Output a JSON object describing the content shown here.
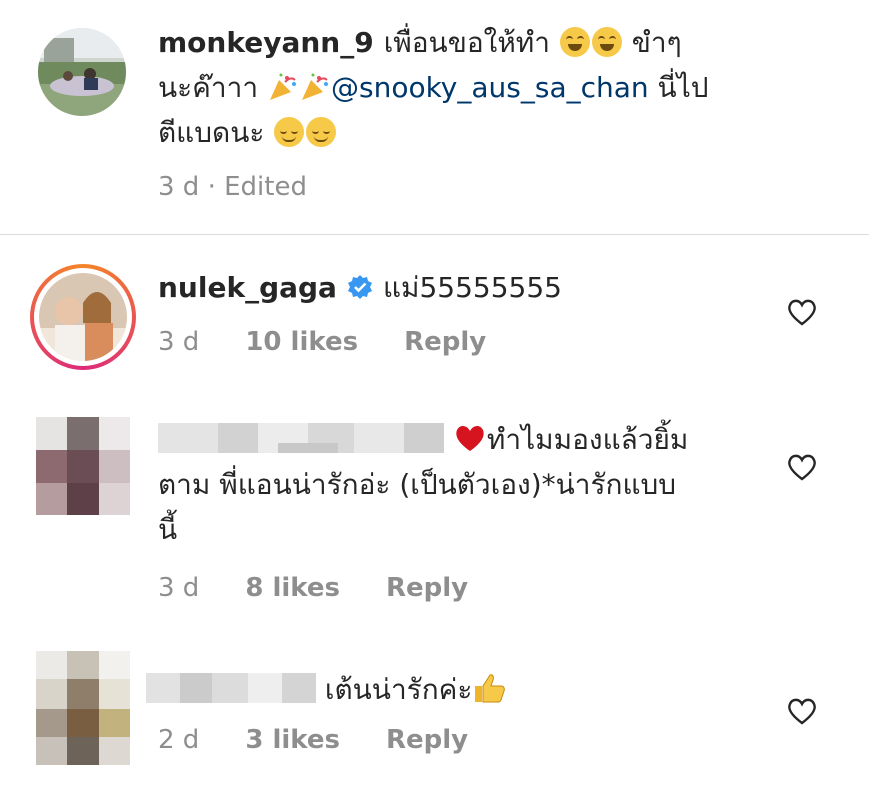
{
  "comments": [
    {
      "username": "monkeyann_9",
      "line1_text": "เพื่อนขอให้ทำ",
      "line1_end": " ขำๆ",
      "line2_start": "นะค๊าาา ",
      "mention": "@snooky_aus_sa_chan",
      "line2_end": " นี่ไป",
      "line3": "ตีแบดนะ ",
      "time": "3 d · Edited"
    },
    {
      "username": "nulek_gaga",
      "text": "แม่55555555",
      "time": "3 d",
      "likes": "10 likes",
      "reply": "Reply"
    },
    {
      "text": "ทำไมมองแล้วยิ้ม",
      "text2": "ตาม พี่แอนน่ารักอ่ะ (เป็นตัวเอง)*น่ารักแบบ",
      "text3": "นี้",
      "time": "3 d",
      "likes": "8 likes",
      "reply": "Reply"
    },
    {
      "text": "เต้นน่ารักค่ะ",
      "time": "2 d",
      "likes": "3 likes",
      "reply": "Reply"
    }
  ],
  "colors": {
    "text": "#262626",
    "muted": "#8e8e8e",
    "mention": "#00376b",
    "verified": "#3897f0",
    "divider": "#dbdbdb"
  },
  "icons": [
    "laughing-emoji",
    "party-popper-emoji",
    "relieved-emoji",
    "verified-badge-icon",
    "red-heart-emoji",
    "thumbs-up-emoji",
    "heart-outline-icon"
  ]
}
